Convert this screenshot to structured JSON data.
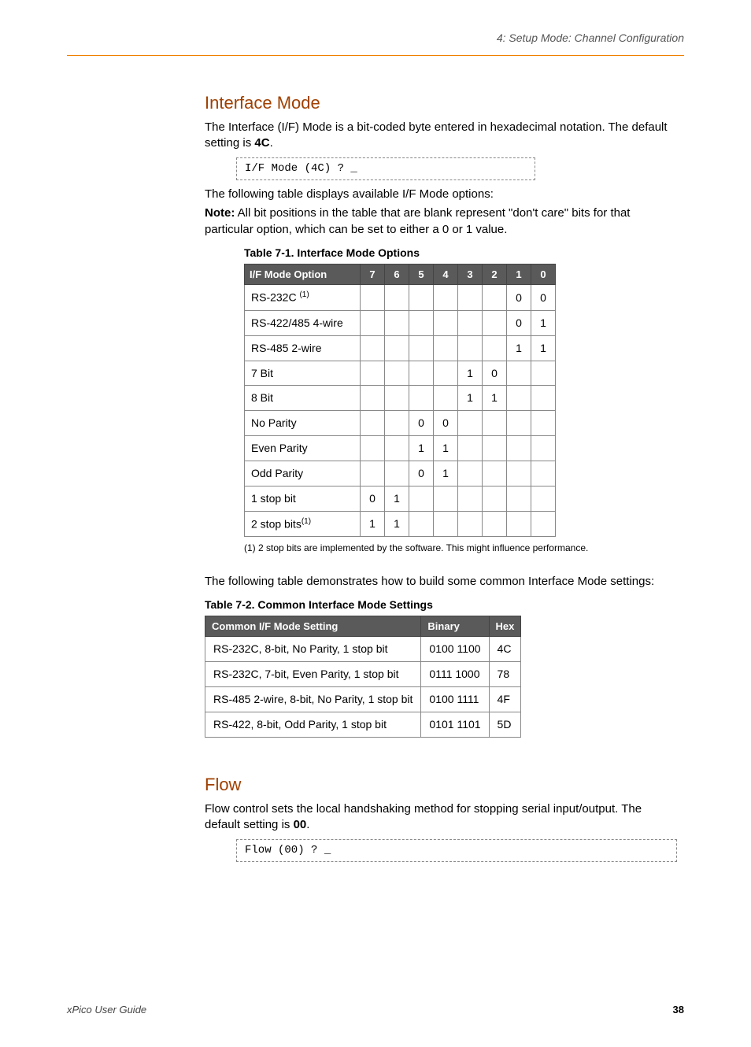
{
  "header": {
    "right": "4: Setup Mode: Channel Configuration"
  },
  "section1": {
    "heading": "Interface Mode",
    "para1a": "The Interface (I/F) Mode is a bit-coded byte entered in hexadecimal notation. The default setting is ",
    "para1_bold": "4C",
    "para1b": ".",
    "codebox1": "I/F Mode (4C) ? _",
    "para2": "The following table displays available I/F Mode options:",
    "note_label": "Note:",
    "note_text": " All bit positions in the table that are blank represent \"don't care\" bits for that particular option, which can be set to either a 0 or 1 value."
  },
  "table1": {
    "title": "Table 7-1. Interface Mode Options",
    "headers": [
      "I/F Mode Option",
      "7",
      "6",
      "5",
      "4",
      "3",
      "2",
      "1",
      "0"
    ],
    "rows": [
      {
        "label_html": "RS-232C <sup>(1)</sup>",
        "b": [
          "",
          "",
          "",
          "",
          "",
          "",
          "0",
          "0"
        ]
      },
      {
        "label_html": "RS-422/485 4-wire",
        "b": [
          "",
          "",
          "",
          "",
          "",
          "",
          "0",
          "1"
        ]
      },
      {
        "label_html": "RS-485 2-wire",
        "b": [
          "",
          "",
          "",
          "",
          "",
          "",
          "1",
          "1"
        ]
      },
      {
        "label_html": "7 Bit",
        "b": [
          "",
          "",
          "",
          "",
          "1",
          "0",
          "",
          ""
        ]
      },
      {
        "label_html": "8 Bit",
        "b": [
          "",
          "",
          "",
          "",
          "1",
          "1",
          "",
          ""
        ]
      },
      {
        "label_html": "No Parity",
        "b": [
          "",
          "",
          "0",
          "0",
          "",
          "",
          "",
          ""
        ]
      },
      {
        "label_html": "Even Parity",
        "b": [
          "",
          "",
          "1",
          "1",
          "",
          "",
          "",
          ""
        ]
      },
      {
        "label_html": "Odd Parity",
        "b": [
          "",
          "",
          "0",
          "1",
          "",
          "",
          "",
          ""
        ]
      },
      {
        "label_html": "1 stop bit",
        "b": [
          "0",
          "1",
          "",
          "",
          "",
          "",
          "",
          ""
        ]
      },
      {
        "label_html": "2 stop bits<sup>(1)</sup>",
        "b": [
          "1",
          "1",
          "",
          "",
          "",
          "",
          "",
          ""
        ]
      }
    ],
    "footnote": "(1) 2 stop bits are implemented by the software. This might influence performance."
  },
  "section2": {
    "para": "The following table demonstrates how to build some common Interface Mode settings:"
  },
  "table2": {
    "title": "Table 7-2. Common Interface Mode Settings",
    "headers": [
      "Common I/F Mode Setting",
      "Binary",
      "Hex"
    ],
    "rows": [
      [
        "RS-232C, 8-bit, No Parity, 1 stop bit",
        "0100 1100",
        "4C"
      ],
      [
        "RS-232C, 7-bit, Even Parity, 1 stop bit",
        "0111 1000",
        "78"
      ],
      [
        "RS-485 2-wire, 8-bit, No Parity, 1 stop bit",
        "0100 1111",
        "4F"
      ],
      [
        "RS-422, 8-bit, Odd Parity, 1 stop bit",
        "0101 1101",
        "5D"
      ]
    ]
  },
  "section3": {
    "heading": "Flow",
    "para_a": "Flow control sets the local handshaking method for stopping serial input/output. The default setting is ",
    "para_bold": "00",
    "para_b": ".",
    "codebox": "Flow (00) ? _"
  },
  "footer": {
    "left": "xPico User Guide",
    "right": "38"
  }
}
